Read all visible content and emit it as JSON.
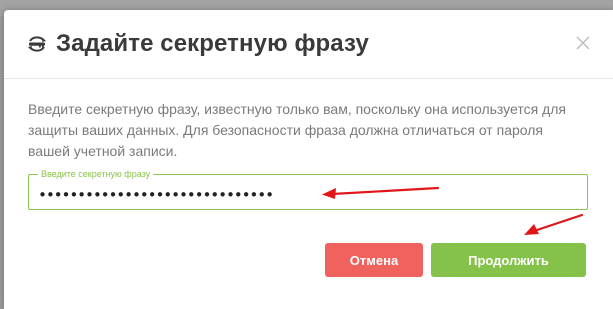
{
  "dialog": {
    "title": "Задайте секретную фразу",
    "title_icon": "key-cycle-icon",
    "close_icon": "close-icon",
    "description": "Введите секретную фразу, известную только вам, поскольку она используется для защиты ваших данных. Для безопасности фраза должна отличаться от пароля вашей учетной записи.",
    "field": {
      "label": "Введите секретную фразу",
      "value": "••••••••••••••••••••••••••••••"
    },
    "buttons": {
      "cancel_label": "Отмена",
      "continue_label": "Продолжить"
    }
  },
  "colors": {
    "accent_green": "#84c24a",
    "cancel_red": "#f0625d",
    "annotation_red": "#e0161b"
  }
}
